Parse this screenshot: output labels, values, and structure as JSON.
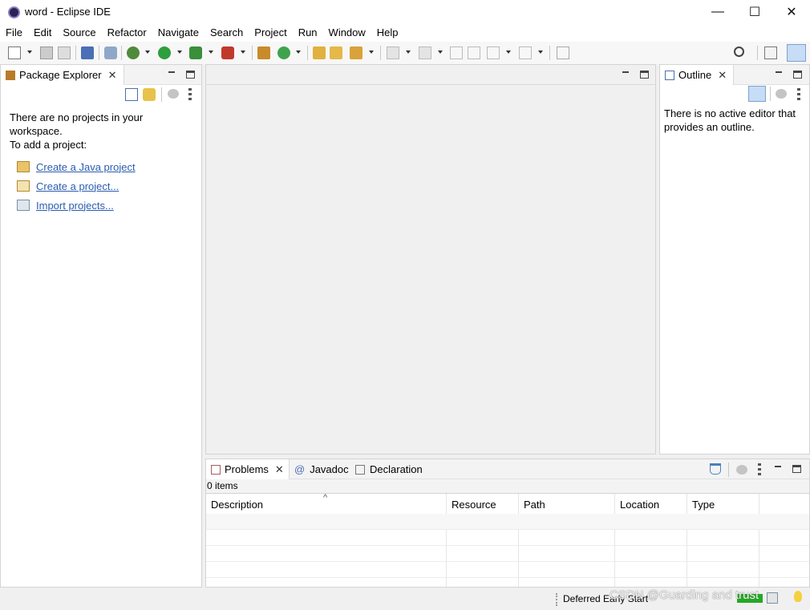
{
  "window": {
    "title": "word - Eclipse IDE",
    "minimize": "—",
    "maximize": "☐",
    "close": "✕"
  },
  "menu": [
    "File",
    "Edit",
    "Source",
    "Refactor",
    "Navigate",
    "Search",
    "Project",
    "Run",
    "Window",
    "Help"
  ],
  "package_explorer": {
    "tab_label": "Package Explorer",
    "message_line1": "There are no projects in your",
    "message_line2": "workspace.",
    "message_line3": "To add a project:",
    "links": [
      "Create a Java project",
      "Create a project...",
      "Import projects..."
    ]
  },
  "outline": {
    "tab_label": "Outline",
    "message_line1": "There is no active editor that",
    "message_line2": "provides an outline."
  },
  "bottom": {
    "tabs": [
      "Problems",
      "Javadoc",
      "Declaration"
    ],
    "items_count": "0 items",
    "columns": [
      "Description",
      "Resource",
      "Path",
      "Location",
      "Type"
    ]
  },
  "status": {
    "deferred": "Deferred Early Start",
    "watermark": "CSDN @Guarding and trust"
  },
  "colors": {
    "link": "#2a5db0",
    "accent_green": "#22aa22",
    "selected_tool_bg": "#c7dcf5"
  }
}
